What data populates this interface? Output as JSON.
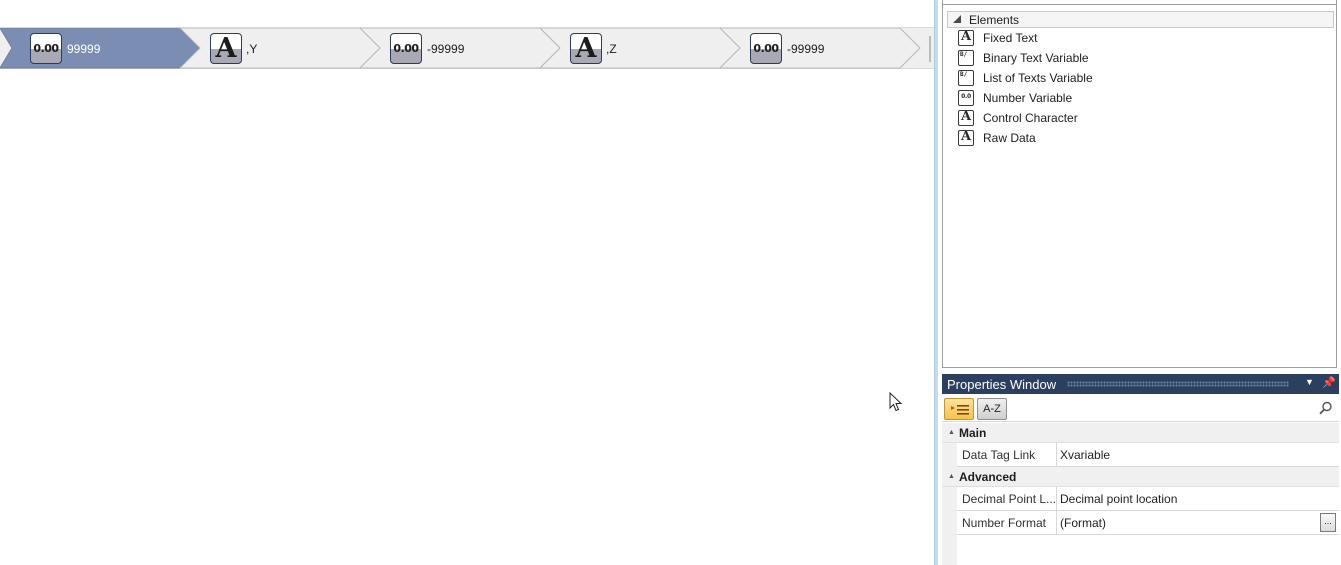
{
  "crumbs": [
    {
      "type": "number",
      "token": "0.00",
      "label": "99999",
      "selected": true
    },
    {
      "type": "text",
      "token": "A",
      "label": ",Y",
      "selected": false
    },
    {
      "type": "number",
      "token": "0.00",
      "label": "-99999",
      "selected": false
    },
    {
      "type": "text",
      "token": "A",
      "label": ",Z",
      "selected": false
    },
    {
      "type": "number",
      "token": "0.00",
      "label": "-99999",
      "selected": false
    }
  ],
  "colors": {
    "crumb_selected": "#7b8db3",
    "crumb_normal": "#efefef",
    "titlebar": "#2b3f61",
    "accent_button": "#f7c24a",
    "splitter": "#c5dbee"
  },
  "toolbox": {
    "group_label": "Elements",
    "items": [
      {
        "label": "Fixed Text",
        "icon": "fixed-text-icon",
        "glyph": "A"
      },
      {
        "label": "Binary Text Variable",
        "icon": "binary-text-variable-icon",
        "glyph": "B/"
      },
      {
        "label": "List of Texts Variable",
        "icon": "list-of-texts-variable-icon",
        "glyph": "B/"
      },
      {
        "label": "Number Variable",
        "icon": "number-variable-icon",
        "glyph": "0.0"
      },
      {
        "label": "Control Character",
        "icon": "control-character-icon",
        "glyph": "A"
      },
      {
        "label": "Raw Data",
        "icon": "raw-data-icon",
        "glyph": "A"
      }
    ]
  },
  "properties": {
    "title": "Properties Window",
    "az_label": "A-Z",
    "categories": [
      {
        "name": "Main",
        "rows": [
          {
            "key": "Data Tag Link",
            "value": "Xvariable"
          }
        ]
      },
      {
        "name": "Advanced",
        "rows": [
          {
            "key": "Decimal Point L...",
            "value": "Decimal point location"
          },
          {
            "key": "Number Format",
            "value": "(Format)",
            "ellipsis": "..."
          }
        ]
      }
    ]
  }
}
